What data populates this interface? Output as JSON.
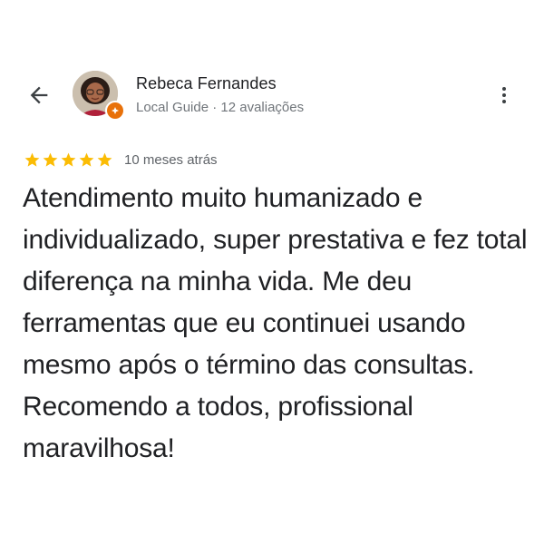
{
  "header": {
    "back_icon": "arrow-back-icon",
    "reviewer_name": "Rebeca Fernandes",
    "reviewer_meta": "Local Guide · 12 avaliações",
    "more_icon": "more-vert-icon",
    "badge_color": "#e8710a"
  },
  "review": {
    "rating": 5,
    "rating_max": 5,
    "star_color": "#fbbc04",
    "date": "10 meses atrás",
    "text": "Atendimento muito humanizado e individualizado, super prestativa e fez total diferença na minha vida. Me deu ferramentas que eu continuei usando mesmo após o término das consultas. Recomendo a todos, profissional maravilhosa!"
  }
}
